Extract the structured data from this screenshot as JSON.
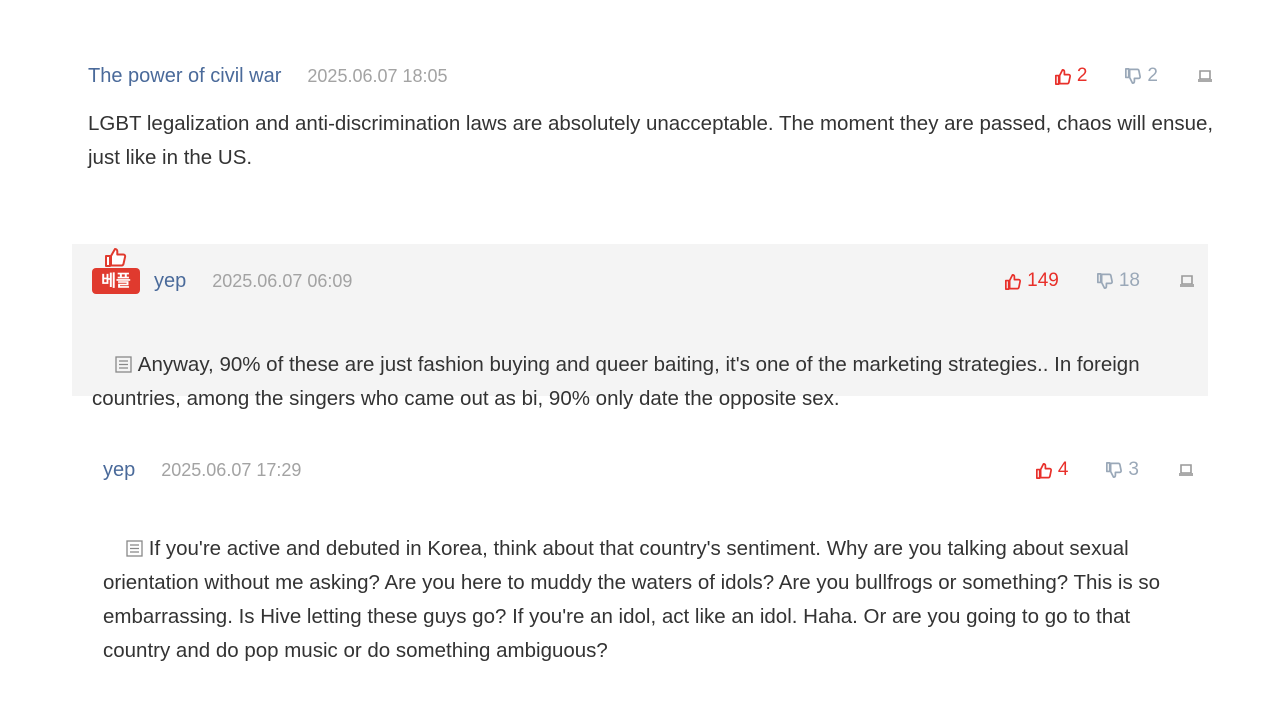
{
  "comments": [
    {
      "author": "The power of civil war",
      "date": "2025.06.07 18:05",
      "likes": "2",
      "dislikes": "2",
      "text": "LGBT legalization and anti-discrimination laws are absolutely unacceptable. The moment they are passed, chaos will ensue, just like in the US.",
      "best": false
    },
    {
      "author": "yep",
      "date": "2025.06.07 06:09",
      "likes": "149",
      "dislikes": "18",
      "text": "Anyway, 90% of these are just fashion buying and queer baiting, it's one of the marketing strategies.. In foreign countries, among the singers who came out as bi, 90% only date the opposite sex.",
      "best": true,
      "badge_label": "베플"
    },
    {
      "author": "yep",
      "date": "2025.06.07 17:29",
      "likes": "4",
      "dislikes": "3",
      "text": "If you're active and debuted in Korea, think about that country's sentiment. Why are you talking about sexual orientation without me asking? Are you here to muddy the waters of idols? Are you bullfrogs or something? This is so embarrassing. Is Hive letting these guys go? If you're an idol, act like an idol. Haha. Or are you going to go to that country and do pop music or do something ambiguous?",
      "best": false
    }
  ],
  "icons": {
    "like": "thumbs-up-icon",
    "dislike": "thumbs-down-icon",
    "report": "report-icon",
    "memo": "memo-icon"
  },
  "colors": {
    "author": "#4a6a9a",
    "date": "#a3a3a3",
    "like": "#e8302a",
    "dislike": "#9aa8b8",
    "best_background": "#f4f4f4",
    "badge": "#e03a2e"
  }
}
